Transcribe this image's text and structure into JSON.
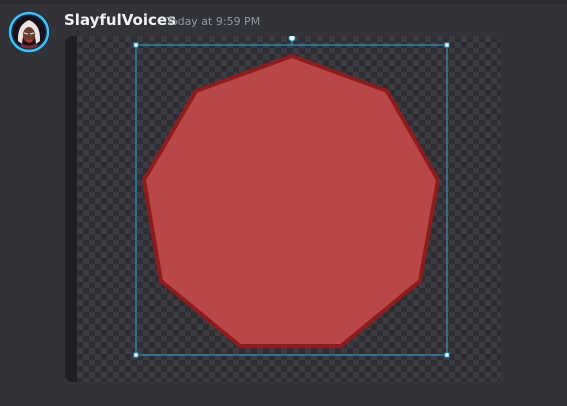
{
  "message": {
    "username": "SlayfulVoices",
    "timestamp": "Today at 9:59 PM"
  },
  "attachment": {
    "shape": "nonagon",
    "fill_color": "#bb4646",
    "stroke_color": "#8e1c1c",
    "selection_color": "#29a8e0",
    "background": "transparent-checkerboard"
  }
}
